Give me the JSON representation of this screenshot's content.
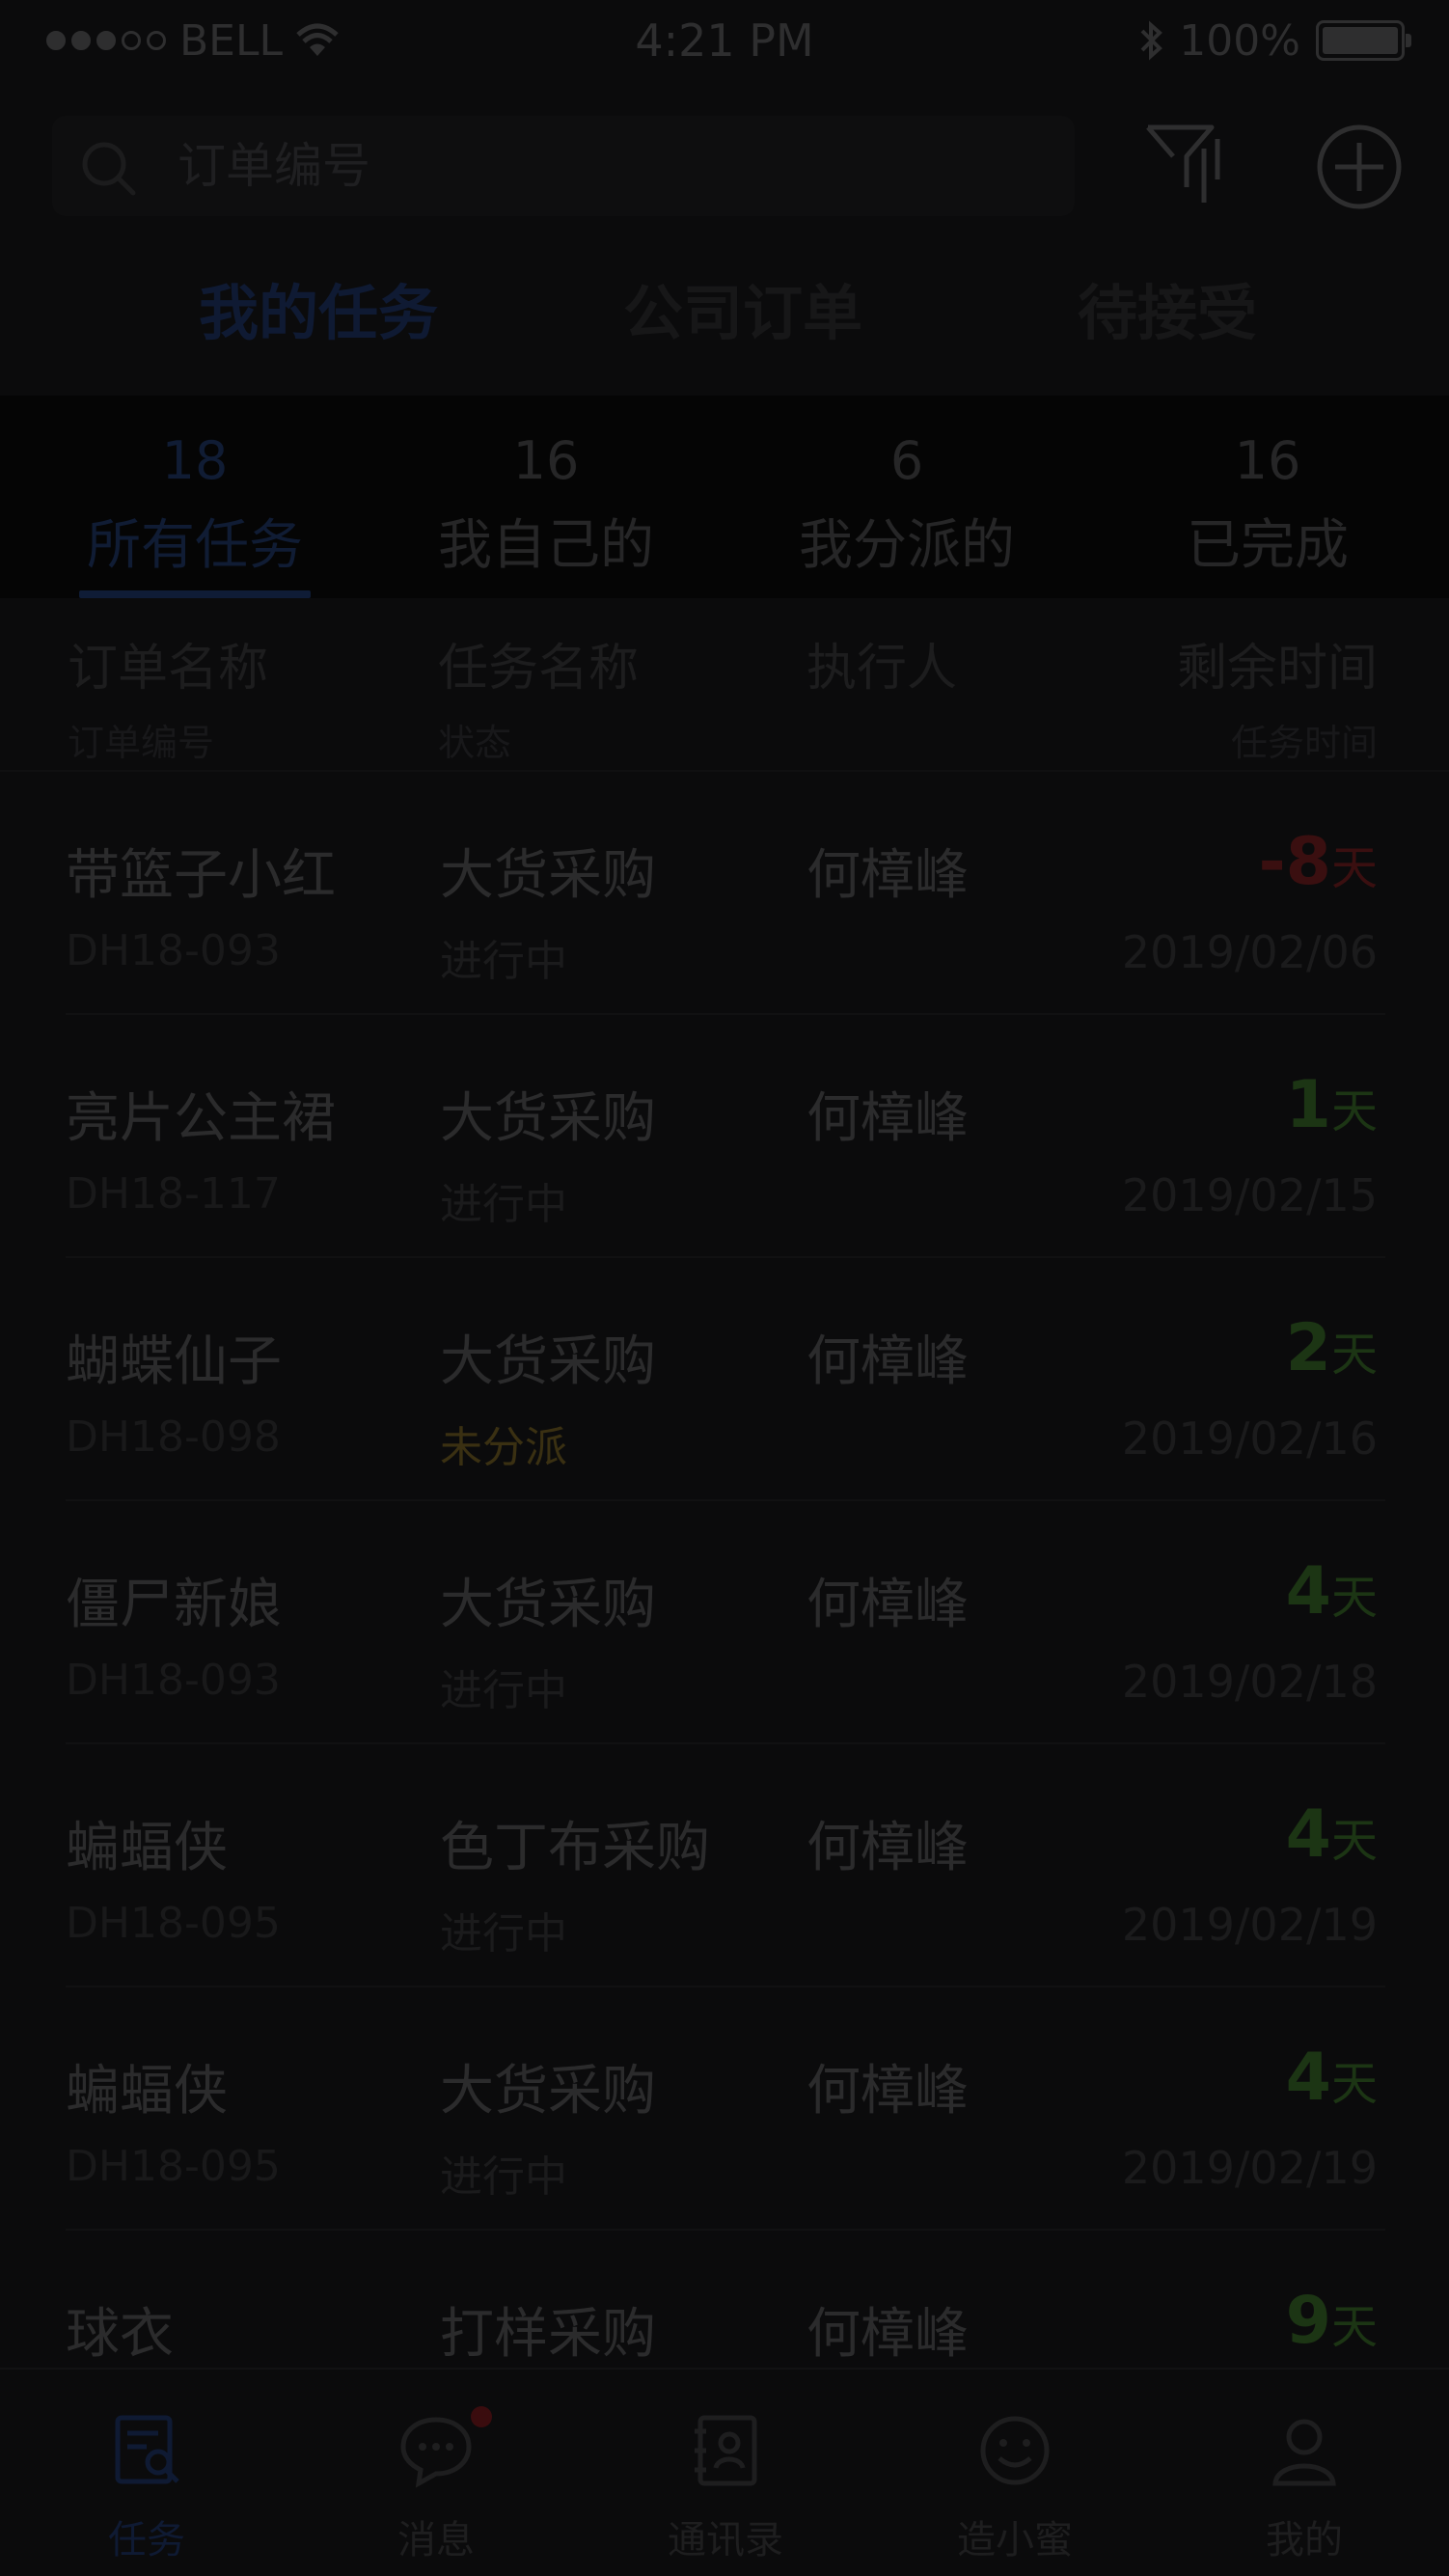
{
  "status_bar": {
    "carrier": "BELL",
    "time": "4:21 PM",
    "battery": "100%",
    "signal_bars": 3
  },
  "search": {
    "placeholder": "订单编号"
  },
  "top_tabs": [
    {
      "label": "我的任务",
      "active": true
    },
    {
      "label": "公司订单",
      "active": false
    },
    {
      "label": "待接受",
      "active": false
    }
  ],
  "sub_tabs": [
    {
      "count": "18",
      "label": "所有任务",
      "active": true
    },
    {
      "count": "16",
      "label": "我自己的",
      "active": false
    },
    {
      "count": "6",
      "label": "我分派的",
      "active": false
    },
    {
      "count": "16",
      "label": "已完成",
      "active": false
    }
  ],
  "list_header": {
    "col1_main": "订单名称",
    "col1_sub": "订单编号",
    "col2_main": "任务名称",
    "col2_sub": "状态",
    "col3_main": "执行人",
    "col4_main": "剩余时间",
    "col4_sub": "任务时间"
  },
  "rows": [
    {
      "order_name": "带篮子小红",
      "order_no": "DH18-093",
      "task": "大货采购",
      "status": "进行中",
      "assignee": "何樟峰",
      "days": "-8",
      "unit": "天",
      "date": "2019/02/06"
    },
    {
      "order_name": "亮片公主裙",
      "order_no": "DH18-117",
      "task": "大货采购",
      "status": "进行中",
      "assignee": "何樟峰",
      "days": "1",
      "unit": "天",
      "date": "2019/02/15"
    },
    {
      "order_name": "蝴蝶仙子",
      "order_no": "DH18-098",
      "task": "大货采购",
      "status": "未分派",
      "assignee": "何樟峰",
      "days": "2",
      "unit": "天",
      "date": "2019/02/16"
    },
    {
      "order_name": "僵尸新娘",
      "order_no": "DH18-093",
      "task": "大货采购",
      "status": "进行中",
      "assignee": "何樟峰",
      "days": "4",
      "unit": "天",
      "date": "2019/02/18"
    },
    {
      "order_name": "蝙蝠侠",
      "order_no": "DH18-095",
      "task": "色丁布采购",
      "status": "进行中",
      "assignee": "何樟峰",
      "days": "4",
      "unit": "天",
      "date": "2019/02/19"
    },
    {
      "order_name": "蝙蝠侠",
      "order_no": "DH18-095",
      "task": "大货采购",
      "status": "进行中",
      "assignee": "何樟峰",
      "days": "4",
      "unit": "天",
      "date": "2019/02/19"
    },
    {
      "order_name": "球衣",
      "order_no": "",
      "task": "打样采购",
      "status": "",
      "assignee": "何樟峰",
      "days": "9",
      "unit": "天",
      "date": ""
    }
  ],
  "tabbar": [
    {
      "label": "任务",
      "icon": "task-list-icon",
      "active": true
    },
    {
      "label": "消息",
      "icon": "chat-bubble-icon",
      "active": false,
      "badge": true
    },
    {
      "label": "通讯录",
      "icon": "contacts-book-icon",
      "active": false
    },
    {
      "label": "造小蜜",
      "icon": "smiley-icon",
      "active": false
    },
    {
      "label": "我的",
      "icon": "user-profile-icon",
      "active": false
    }
  ],
  "colors": {
    "background": "#0b0b0c",
    "accent_blue": "#101c34",
    "overdue_red": "#3a0f10",
    "on_time_green": "#1c3514",
    "pending_yellow": "#3a3012"
  }
}
